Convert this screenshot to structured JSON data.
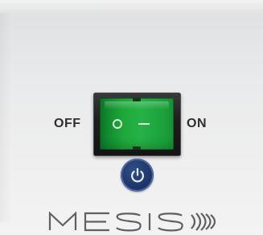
{
  "panel": {
    "off_label": "OFF",
    "on_label": "ON",
    "rocker_symbols": [
      "O",
      "—"
    ]
  },
  "power": {
    "icon": "power-icon",
    "state": "off"
  },
  "brand": {
    "name": "MESIS",
    "mark_icon": "signal-waves-icon"
  },
  "colors": {
    "rocker_green": "#1ea63a",
    "power_blue": "#1e3667",
    "label_text": "#2f2f2f",
    "panel_bg": "#e9eaeb"
  }
}
